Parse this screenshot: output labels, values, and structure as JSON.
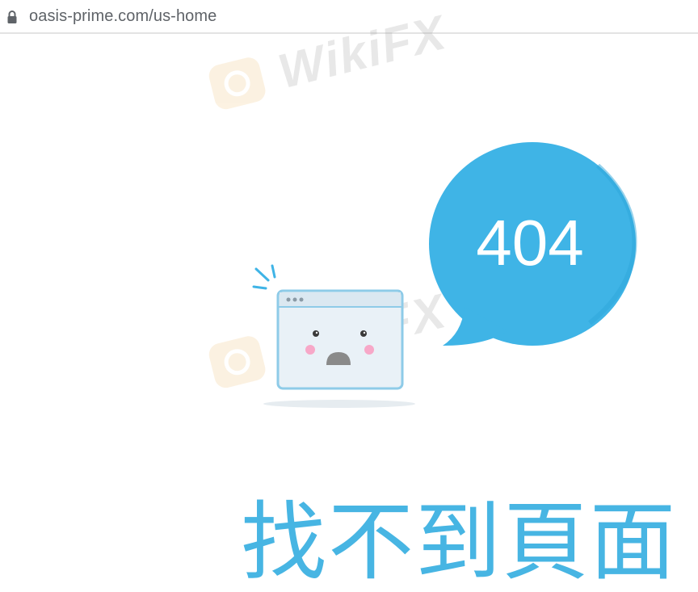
{
  "browser": {
    "url": "oasis-prime.com/us-home",
    "lock_icon": "lock-icon"
  },
  "watermark": {
    "text": "WikiFX",
    "logo_icon": "wikifx-eagle-logo"
  },
  "error": {
    "code": "404",
    "message": "找不到頁面"
  },
  "colors": {
    "accent_blue": "#3fb4e6",
    "title_blue": "#47b5e3",
    "window_frame": "#8ecbe8",
    "window_fill": "#e9f1f7",
    "cheek_pink": "#f7a8c8",
    "mouth_gray": "#8a8a8a"
  }
}
